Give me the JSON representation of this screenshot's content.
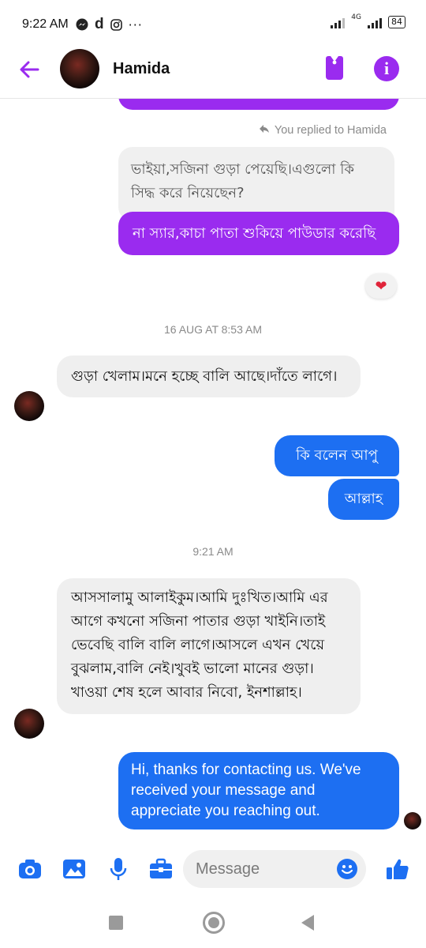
{
  "status_bar": {
    "time": "9:22 AM",
    "left_icons": [
      "messenger-icon",
      "d-icon",
      "instagram-icon",
      "more-dots-icon"
    ],
    "network": "4G",
    "battery": "84"
  },
  "header": {
    "contact_name": "Hamida",
    "icons": [
      "back-arrow-icon",
      "tag-icon",
      "info-icon"
    ],
    "accent_color": "#9a2bef"
  },
  "messages": {
    "reply_note": "You replied to Hamida",
    "quoted_text": "ভাইয়া,সজিনা গুড়া পেয়েছি।এগুলো কি সিদ্ধ করে নিয়েছেন?",
    "reply_text": "না স্যার,কাচা পাতা শুকিয়ে পাউডার করেছি",
    "reaction": "heart",
    "date_separator_1": "16 AUG AT 8:53 AM",
    "incoming_1": "গুড়া খেলাম।মনে হচ্ছে বালি আছে।দাঁতে লাগে।",
    "outgoing_1": "কি বলেন আপু",
    "outgoing_2": "আল্লাহ",
    "date_separator_2": "9:21 AM",
    "incoming_2": "আসসালামু আলাইকুম।আমি দুঃখিত।আমি এর আগে কখনো সজিনা পাতার গুড়া খাইনি।তাই ভেবেছি বালি বালি লাগে।আসলে এখন খেয়ে বুঝলাম,বালি নেই।খুবই ভালো মানের গুড়া।খাওয়া শেষ হলে আবার নিবো, ইনশাল্লাহ।",
    "outgoing_3": "Hi, thanks for contacting us. We've received your message and appreciate you reaching out."
  },
  "composer": {
    "placeholder": "Message",
    "icons": [
      "camera-icon",
      "gallery-icon",
      "microphone-icon",
      "briefcase-icon",
      "emoji-icon",
      "thumbs-up-icon"
    ],
    "icon_color": "#1d6ff2"
  },
  "nav_bar": {
    "icons": [
      "recents-square-icon",
      "home-circle-icon",
      "back-triangle-icon"
    ]
  }
}
